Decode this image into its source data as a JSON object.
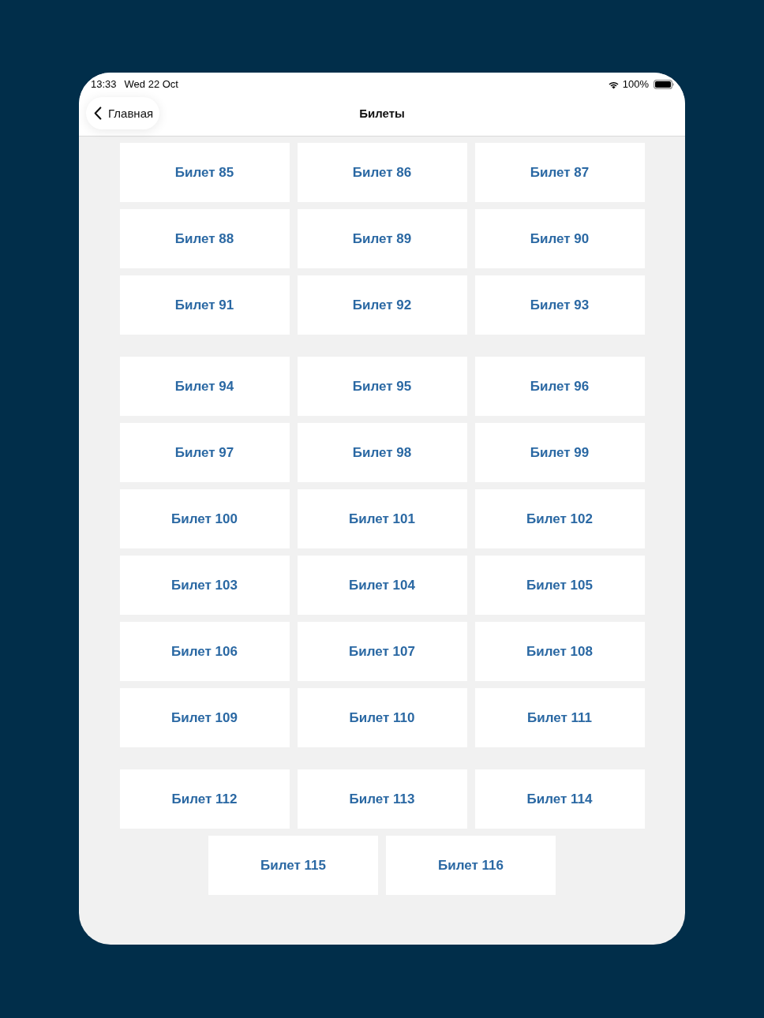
{
  "status_bar": {
    "time": "13:33",
    "date": "Wed 22 Oct",
    "battery": "100%"
  },
  "nav": {
    "back_label": "Главная",
    "title": "Билеты"
  },
  "sections": [
    {
      "tickets": [
        "Билет 85",
        "Билет 86",
        "Билет 87",
        "Билет 88",
        "Билет 89",
        "Билет 90",
        "Билет 91",
        "Билет 92",
        "Билет 93"
      ]
    },
    {
      "tickets": [
        "Билет 94",
        "Билет 95",
        "Билет 96",
        "Билет 97",
        "Билет 98",
        "Билет 99",
        "Билет 100",
        "Билет 101",
        "Билет 102",
        "Билет 103",
        "Билет 104",
        "Билет 105",
        "Билет 106",
        "Билет 107",
        "Билет 108",
        "Билет 109",
        "Билет 110",
        "Билет 111"
      ]
    },
    {
      "tickets": [
        "Билет 112",
        "Билет 113",
        "Билет 114",
        "Билет 115",
        "Билет 116"
      ]
    }
  ]
}
